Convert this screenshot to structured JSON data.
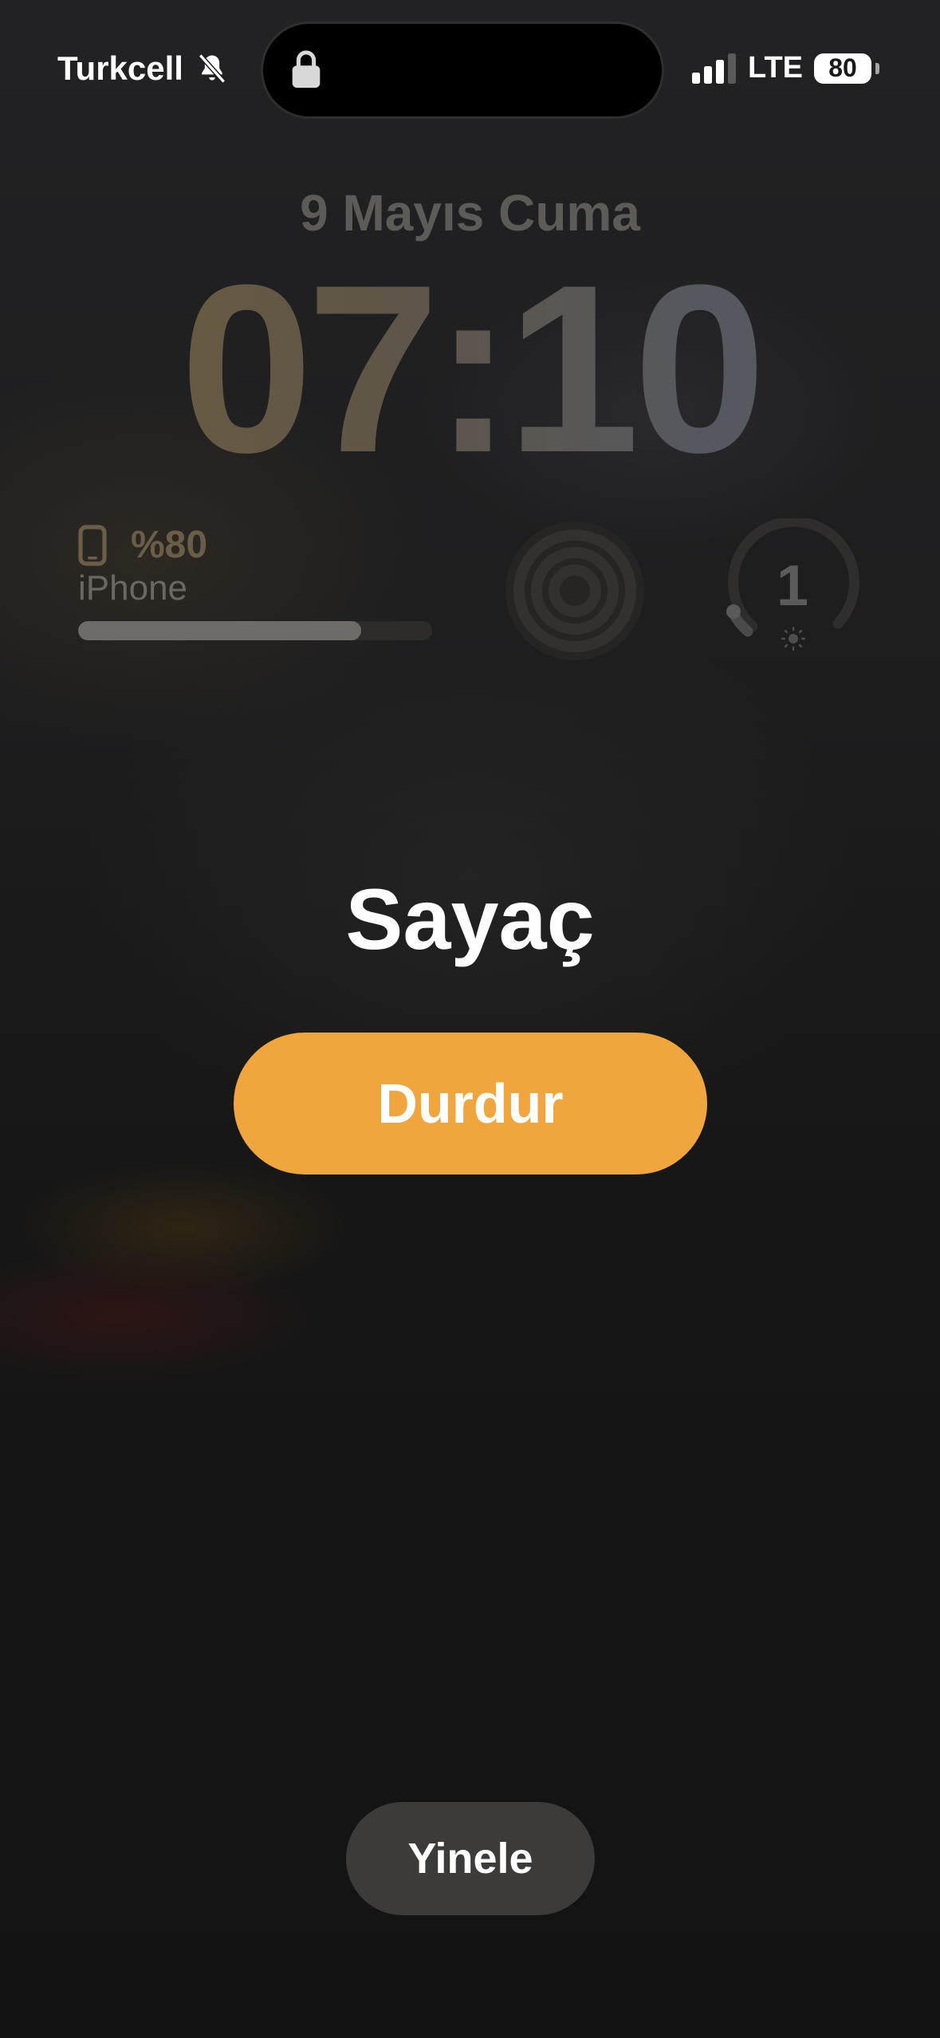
{
  "status_bar": {
    "carrier": "Turkcell",
    "silent_icon": "bell-slash-icon",
    "lock_icon": "lock-icon",
    "signal_icon": "cellular-signal-icon",
    "network": "LTE",
    "battery": "80"
  },
  "lockscreen": {
    "date": "9 Mayıs Cuma",
    "time": "07:10"
  },
  "widgets": {
    "battery": {
      "icon": "iphone-icon",
      "percent_label": "%80",
      "device": "iPhone",
      "level": 0.8
    },
    "activity": {
      "icon": "activity-rings-icon"
    },
    "timer": {
      "value": "1",
      "icon": "sun-icon"
    }
  },
  "alarm": {
    "title": "Sayaç",
    "stop_label": "Durdur",
    "repeat_label": "Yinele",
    "accent_color": "#f0a53f"
  }
}
